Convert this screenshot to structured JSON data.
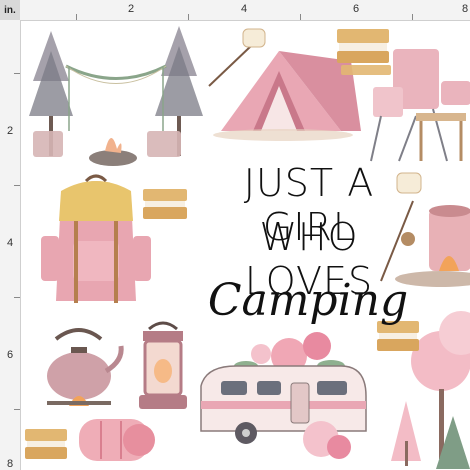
{
  "ruler": {
    "unit_label": "in.",
    "top_numbers": [
      "2",
      "4",
      "6",
      "8"
    ],
    "left_numbers": [
      "2",
      "4",
      "6",
      "8"
    ]
  },
  "design": {
    "line1": "JUST A GIRL",
    "line2": "WHO LOVES",
    "line3": "Camping",
    "palette": {
      "pink": "#e9a7b4",
      "dark_pink": "#c9788a",
      "pine": "#7b7b86",
      "cream": "#f3e3c3",
      "ink": "#111111"
    },
    "illustrations": [
      "forest-swing-scene",
      "tent",
      "smores",
      "camp-chair",
      "backpack",
      "marshmallow-stick",
      "mug-fire",
      "kettle",
      "lantern",
      "camper-trailer",
      "pink-trees",
      "sleeping-bag"
    ]
  }
}
